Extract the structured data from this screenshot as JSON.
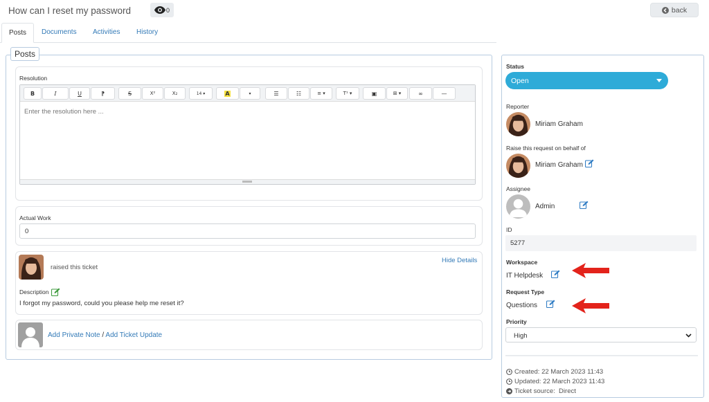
{
  "header": {
    "title": "How can I reset my password",
    "watch_count": "0",
    "back_label": "back"
  },
  "tabs": [
    {
      "label": "Posts"
    },
    {
      "label": "Documents"
    },
    {
      "label": "Activities"
    },
    {
      "label": "History"
    }
  ],
  "posts": {
    "legend": "Posts",
    "resolution_label": "Resolution",
    "editor_placeholder": "Enter the resolution here ...",
    "toolbar": {
      "bold": "B",
      "italic": "I",
      "underline": "U",
      "eraser": "⁋",
      "strike": "S",
      "sup": "X²",
      "sub": "X₂",
      "fontsize": "14 ▾",
      "color": "A",
      "more": "▾",
      "ul": "☰",
      "ol": "☷",
      "align": "≡ ▾",
      "style": "T¹ ▾",
      "image": "▣",
      "table": "⊞ ▾",
      "link": "∞",
      "hr": "—"
    },
    "actual_work_label": "Actual Work",
    "actual_work_value": "0",
    "raised_text": "raised this ticket",
    "hide_details": "Hide Details",
    "description_label": "Description",
    "description_text": "I forgot my password, could you please help me reset it?",
    "add_private_note": "Add Private Note",
    "separator": "/",
    "add_ticket_update": "Add Ticket Update"
  },
  "sidebar": {
    "status_label": "Status",
    "status_value": "Open",
    "reporter_label": "Reporter",
    "reporter_name": "Miriam Graham",
    "behalf_label": "Raise this request on behalf of",
    "behalf_name": "Miriam Graham",
    "assignee_label": "Assignee",
    "assignee_name": "Admin",
    "id_label": "ID",
    "id_value": "5277",
    "workspace_label": "Workspace",
    "workspace_value": "IT Helpdesk",
    "request_type_label": "Request Type",
    "request_type_value": "Questions",
    "priority_label": "Priority",
    "priority_value": "High",
    "created": "Created: 22 March 2023 11:43",
    "updated": "Updated: 22 March 2023 11:43",
    "source": "Ticket source:  Direct"
  },
  "colors": {
    "status_bg": "#2eabd8",
    "link": "#337ab7",
    "arrow": "#e3231b"
  }
}
